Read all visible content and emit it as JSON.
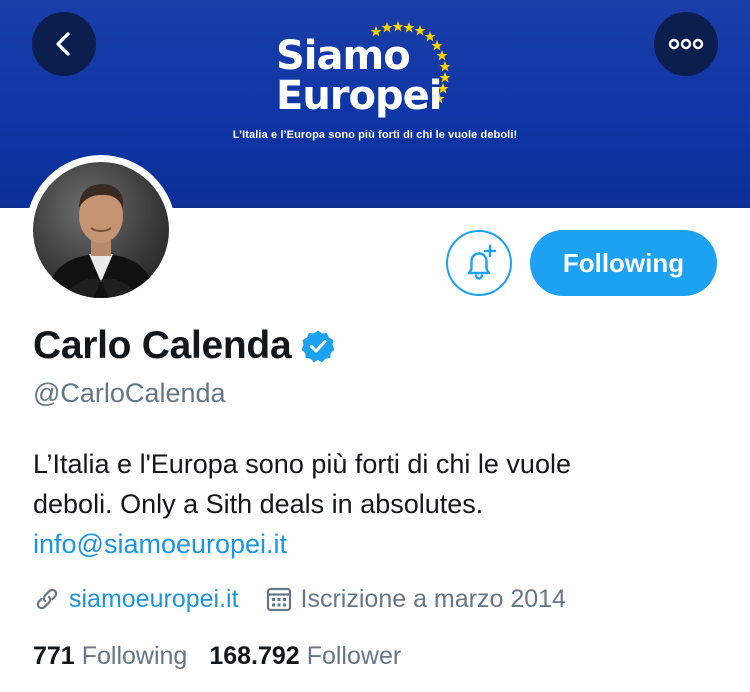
{
  "banner": {
    "logo_line1": "Siamo",
    "logo_line2": "Europei",
    "tagline": "L’Italia e l’Europa sono più forti di chi le vuole deboli!",
    "background_color": "#0e36a6",
    "star_color": "#ffd200"
  },
  "nav": {
    "back_icon": "chevron-left-icon",
    "more_icon": "more-horizontal-icon"
  },
  "actions": {
    "notification_icon": "bell-plus-icon",
    "following_label": "Following",
    "accent_color": "#1da1f2"
  },
  "profile": {
    "name": "Carlo Calenda",
    "verified_icon": "verified-badge-icon",
    "handle": "@CarloCalenda",
    "bio_line1": "L’Italia e l'Europa sono più forti di chi le vuole",
    "bio_line2": "deboli. Only a Sith deals in absolutes.",
    "bio_email": "info@siamoeuropei.it",
    "website": "siamoeuropei.it",
    "joined": "Iscrizione a marzo 2014"
  },
  "stats": {
    "following_count": "771",
    "following_label": "Following",
    "followers_count": "168.792",
    "followers_label": "Follower"
  }
}
